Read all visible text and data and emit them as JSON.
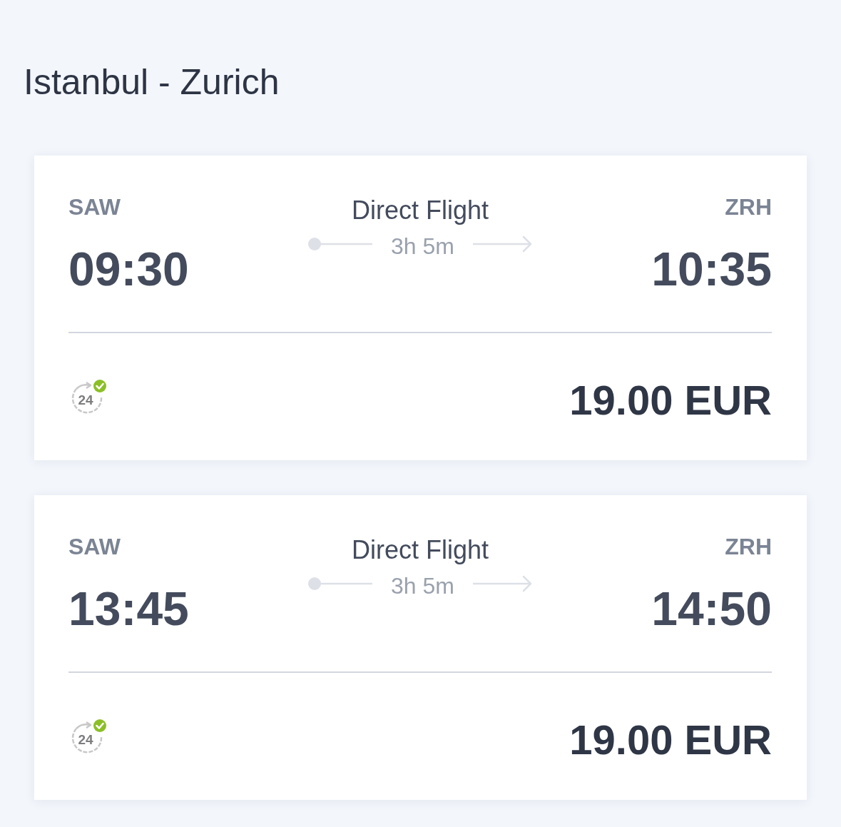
{
  "title": "Istanbul - Zurich",
  "flights": [
    {
      "departure": {
        "code": "SAW",
        "time": "09:30"
      },
      "route": {
        "label": "Direct Flight",
        "duration": "3h 5m"
      },
      "arrival": {
        "code": "ZRH",
        "time": "10:35"
      },
      "icon_text": "24",
      "price": "19.00 EUR"
    },
    {
      "departure": {
        "code": "SAW",
        "time": "13:45"
      },
      "route": {
        "label": "Direct Flight",
        "duration": "3h 5m"
      },
      "arrival": {
        "code": "ZRH",
        "time": "14:50"
      },
      "icon_text": "24",
      "price": "19.00 EUR"
    }
  ]
}
